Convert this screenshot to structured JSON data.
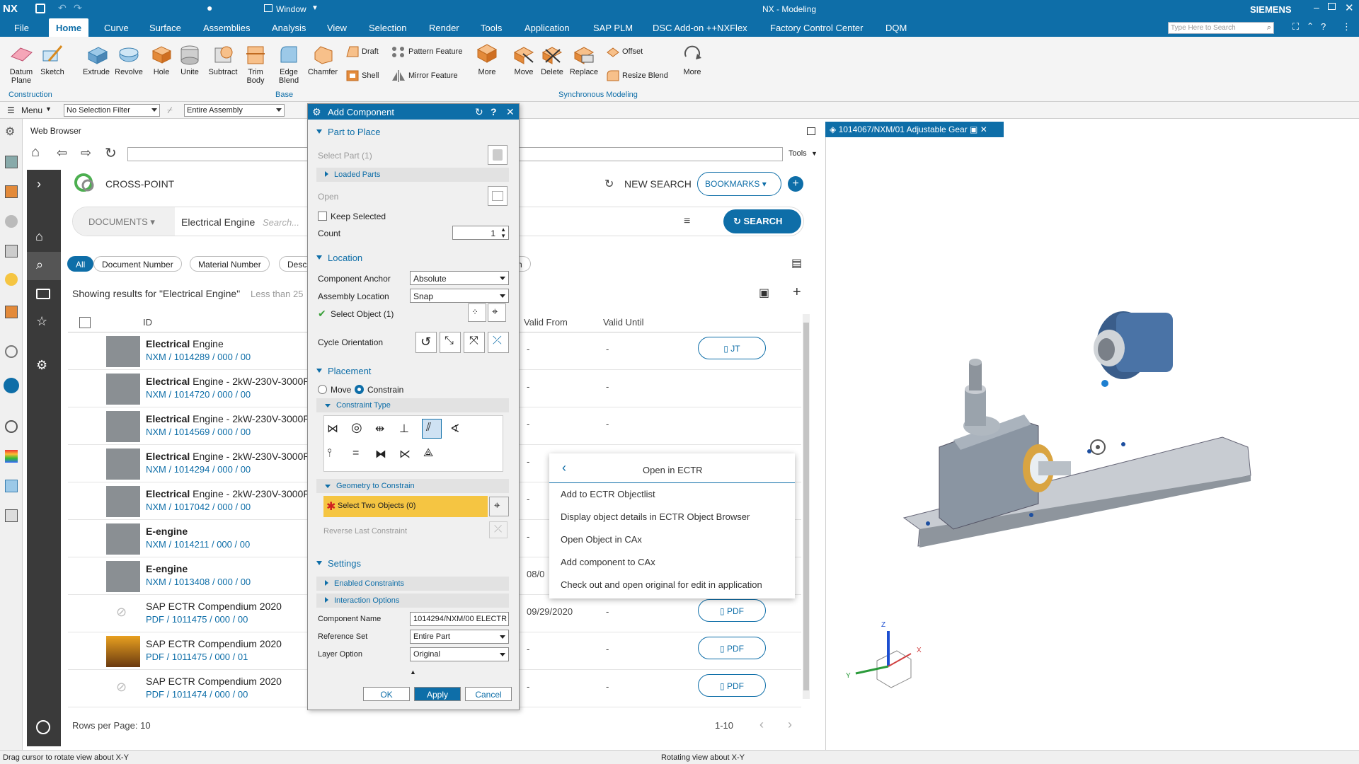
{
  "app": {
    "logo": "NX",
    "title": "NX - Modeling",
    "brand": "SIEMENS",
    "window_menu": "Window",
    "search_placeholder": "Type Here to Search"
  },
  "menubar": [
    "File",
    "Home",
    "Curve",
    "Surface",
    "Assemblies",
    "Analysis",
    "View",
    "Selection",
    "Render",
    "Tools",
    "Application",
    "SAP PLM",
    "DSC Add-on ++NXFlex",
    "Factory Control Center",
    "DQM"
  ],
  "ribbon": {
    "construction": {
      "datum_plane": "Datum Plane",
      "sketch": "Sketch",
      "group": "Construction"
    },
    "base": {
      "extrude": "Extrude",
      "revolve": "Revolve",
      "hole": "Hole",
      "unite": "Unite",
      "subtract": "Subtract",
      "trim_body": "Trim Body",
      "edge_blend": "Edge Blend",
      "chamfer": "Chamfer",
      "draft": "Draft",
      "shell": "Shell",
      "pattern_feature": "Pattern Feature",
      "mirror_feature": "Mirror Feature",
      "more": "More",
      "group": "Base"
    },
    "sync": {
      "move": "Move",
      "delete": "Delete",
      "replace": "Replace",
      "offset": "Offset",
      "resize_blend": "Resize Blend",
      "more": "More",
      "group": "Synchronous Modeling"
    }
  },
  "toolbar2": {
    "menu": "Menu",
    "selection_filter": "No Selection Filter",
    "scope": "Entire Assembly"
  },
  "web_browser": {
    "title": "Web Browser",
    "tools": "Tools",
    "brand": "CROSS-POINT",
    "new_search": "NEW SEARCH",
    "bookmarks": "BOOKMARKS",
    "category": "DOCUMENTS",
    "query": "Electrical Engine",
    "search_placeholder": "Search...",
    "search_btn": "SEARCH",
    "chips": [
      "All",
      "Document Number",
      "Material Number",
      "Desc",
      "n"
    ],
    "results_text": "Showing results for \"Electrical Engine\"",
    "results_hint": "Less than 25",
    "col_id": "ID",
    "col_valid_from": "Valid From",
    "col_valid_until": "Valid Until",
    "rows": [
      {
        "name_bold": "Electrical",
        "name_rest": " Engine",
        "number": "NXM / 1014289 / 000 / 00",
        "from": "-",
        "until": "-",
        "action": "JT"
      },
      {
        "name_bold": "Electrical",
        "name_rest": " Engine - 2kW-230V-3000R",
        "number": "NXM / 1014720 / 000 / 00",
        "from": "-",
        "until": "-",
        "action": ""
      },
      {
        "name_bold": "Electrical",
        "name_rest": " Engine - 2kW-230V-3000R",
        "number": "NXM / 1014569 / 000 / 00",
        "from": "-",
        "until": "-",
        "action": ""
      },
      {
        "name_bold": "Electrical",
        "name_rest": " Engine - 2kW-230V-3000R",
        "number": "NXM / 1014294 / 000 / 00",
        "from": "-",
        "until": "",
        "action": ""
      },
      {
        "name_bold": "Electrical",
        "name_rest": " Engine - 2kW-230V-3000R",
        "number": "NXM / 1017042 / 000 / 00",
        "from": "-",
        "until": "",
        "action": ""
      },
      {
        "name_bold": "E-engine",
        "name_rest": "",
        "number": "NXM / 1014211 / 000 / 00",
        "from": "-",
        "until": "",
        "action": ""
      },
      {
        "name_bold": "E-engine",
        "name_rest": "",
        "number": "NXM / 1013408 / 000 / 00",
        "from": "08/0",
        "until": "",
        "action": ""
      },
      {
        "name_bold": "",
        "name_rest": "SAP ECTR Compendium 2020",
        "number": "PDF / 1011475 / 000 / 00",
        "from": "09/29/2020",
        "until": "-",
        "action": "PDF"
      },
      {
        "name_bold": "",
        "name_rest": "SAP ECTR Compendium 2020",
        "number": "PDF / 1011475 / 000 / 01",
        "from": "-",
        "until": "-",
        "action": "PDF"
      },
      {
        "name_bold": "",
        "name_rest": "SAP ECTR Compendium 2020",
        "number": "PDF / 1011474 / 000 / 00",
        "from": "-",
        "until": "-",
        "action": "PDF"
      }
    ],
    "rows_per_page": "Rows per Page: 10",
    "range": "1-10"
  },
  "context_menu": {
    "title": "Open in ECTR",
    "items": [
      "Add to ECTR Objectlist",
      "Display object details in ECTR Object Browser",
      "Open Object in CAx",
      "Add component to CAx",
      "Check out and open original for edit in application"
    ]
  },
  "dialog": {
    "title": "Add Component",
    "part_to_place": "Part to Place",
    "select_part": "Select Part (1)",
    "loaded_parts": "Loaded Parts",
    "open": "Open",
    "keep_selected": "Keep Selected",
    "count_label": "Count",
    "count_value": "1",
    "location": "Location",
    "component_anchor": "Component Anchor",
    "anchor_value": "Absolute",
    "assembly_location": "Assembly Location",
    "assembly_value": "Snap",
    "select_object": "Select Object (1)",
    "cycle_orientation": "Cycle Orientation",
    "placement": "Placement",
    "move": "Move",
    "constrain": "Constrain",
    "constraint_type": "Constraint Type",
    "geometry_to_constrain": "Geometry to Constrain",
    "select_two_objects": "Select Two Objects (0)",
    "reverse_last_constraint": "Reverse Last Constraint",
    "settings": "Settings",
    "enabled_constraints": "Enabled Constraints",
    "interaction_options": "Interaction Options",
    "component_name_label": "Component Name",
    "component_name_value": "1014294/NXM/00 ELECTR",
    "reference_set_label": "Reference Set",
    "reference_set_value": "Entire Part",
    "layer_option_label": "Layer Option",
    "layer_option_value": "Original",
    "ok": "OK",
    "apply": "Apply",
    "cancel": "Cancel"
  },
  "viewport": {
    "tab": "1014067/NXM/01 Adjustable Gear",
    "axis_x": "X",
    "axis_y": "Y",
    "axis_z": "Z"
  },
  "status": {
    "left": "Drag cursor to rotate view about X-Y",
    "center": "Rotating view about X-Y"
  },
  "colors": {
    "accent": "#0e6ea8",
    "highlight": "#f5c542",
    "nav": "#3a3a3a"
  }
}
